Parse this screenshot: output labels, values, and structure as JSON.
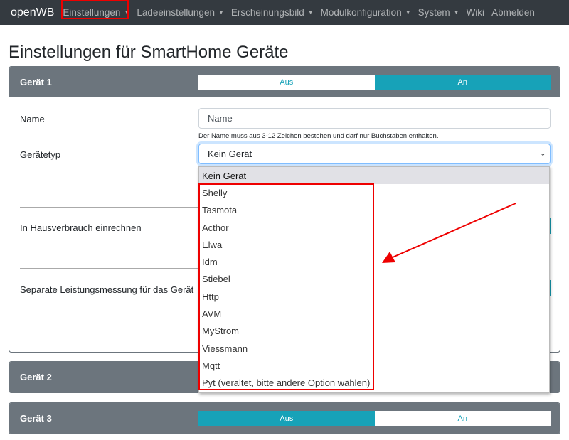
{
  "nav": {
    "brand": "openWB",
    "items": [
      {
        "label": "Einstellungen",
        "caret": true
      },
      {
        "label": "Ladeeinstellungen",
        "caret": true
      },
      {
        "label": "Erscheinungsbild",
        "caret": true
      },
      {
        "label": "Modulkonfiguration",
        "caret": true
      },
      {
        "label": "System",
        "caret": true
      },
      {
        "label": "Wiki",
        "caret": false
      },
      {
        "label": "Abmelden",
        "caret": false
      }
    ]
  },
  "page_title": "Einstellungen für SmartHome Geräte",
  "devices": [
    {
      "title": "Gerät 1",
      "off_label": "Aus",
      "on_label": "An",
      "state": "An"
    },
    {
      "title": "Gerät 2"
    },
    {
      "title": "Gerät 3",
      "off_label": "Aus",
      "on_label": "An",
      "state": "Aus"
    }
  ],
  "form": {
    "name_label": "Name",
    "name_placeholder": "Name",
    "name_help": "Der Name muss aus 3-12 Zeichen bestehen und darf nur Buchstaben enthalten.",
    "type_label": "Gerätetyp",
    "type_value": "Kein Gerät",
    "house_label": "In Hausverbrauch einrechnen",
    "separate_label": "Separate Leistungsmessung für das Gerät"
  },
  "dropdown": [
    "Kein Gerät",
    "Shelly",
    "Tasmota",
    "Acthor",
    "Elwa",
    "Idm",
    "Stiebel",
    "Http",
    "AVM",
    "MyStrom",
    "Viessmann",
    "Mqtt",
    "Pyt (veraltet, bitte andere Option wählen)"
  ],
  "colors": {
    "accent": "#17a2b8",
    "navbar": "#343a40",
    "card_header": "#6c757d",
    "annotation": "#e00000"
  }
}
